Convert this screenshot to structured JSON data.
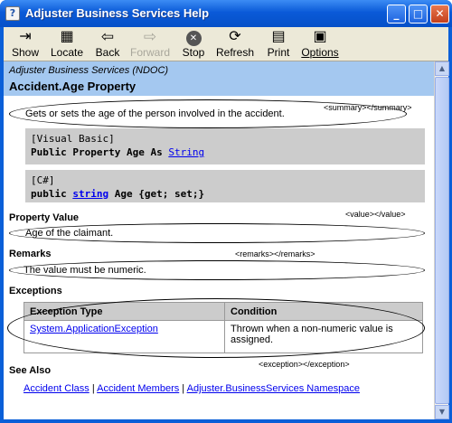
{
  "window": {
    "title": "Adjuster Business Services Help",
    "app_icon_glyph": "?",
    "controls": {
      "minimize": "_",
      "maximize": "□",
      "close": "✕"
    }
  },
  "toolbar": {
    "buttons": [
      {
        "label": "Show",
        "icon": "show-icon",
        "glyph": "⇥",
        "enabled": true
      },
      {
        "label": "Locate",
        "icon": "locate-icon",
        "glyph": "▦",
        "enabled": true
      },
      {
        "label": "Back",
        "icon": "back-arrow-icon",
        "glyph": "⇦",
        "enabled": true
      },
      {
        "label": "Forward",
        "icon": "forward-arrow-icon",
        "glyph": "⇨",
        "enabled": false
      },
      {
        "label": "Stop",
        "icon": "stop-icon",
        "glyph": "✕",
        "enabled": true
      },
      {
        "label": "Refresh",
        "icon": "refresh-icon",
        "glyph": "⟳",
        "enabled": true
      },
      {
        "label": "Print",
        "icon": "print-icon",
        "glyph": "▤",
        "enabled": true
      },
      {
        "label": "Options",
        "icon": "options-icon",
        "glyph": "▣",
        "enabled": true
      }
    ]
  },
  "page": {
    "namespace_title": "Adjuster Business Services (NDOC)",
    "property_title": "Accident.Age Property",
    "summary_tag": "<summary></summary>",
    "summary_text": "Gets or sets the age of the person involved in the accident.",
    "vb": {
      "lang": "[Visual Basic]",
      "code_prefix": "Public Property Age As ",
      "type_link": "String"
    },
    "cs": {
      "lang": "[C#]",
      "code_prefix": "public ",
      "type_link": "string",
      "code_suffix": " Age {get; set;}"
    },
    "property_value_heading": "Property Value",
    "value_tag": "<value></value>",
    "value_text": "Age of the claimant.",
    "remarks_heading": "Remarks",
    "remarks_tag": "<remarks></remarks>",
    "remarks_text": "The value must be numeric.",
    "exceptions_heading": "Exceptions",
    "exceptions_table": {
      "headers": [
        "Exception Type",
        "Condition"
      ],
      "rows": [
        {
          "type": "System.ApplicationException",
          "condition": "Thrown when a non-numeric value is assigned."
        }
      ]
    },
    "exception_tag": "<exception></exception>",
    "see_also_heading": "See Also",
    "see_also_links": [
      "Accident Class",
      "Accident Members",
      "Adjuster.BusinessServices Namespace"
    ],
    "separator": "|"
  },
  "colors": {
    "titlebar": "#0a5ad8",
    "toolbar_bg": "#ece9d8",
    "header_band": "#a4c8f0",
    "code_bg": "#cccccc",
    "link": "#0000ee"
  }
}
